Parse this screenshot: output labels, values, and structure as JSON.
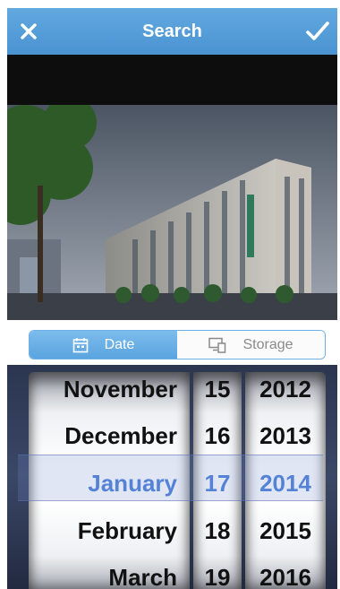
{
  "header": {
    "title": "Search",
    "close_icon": "close-icon",
    "confirm_icon": "checkmark-icon"
  },
  "tabs": [
    {
      "label": "Date",
      "icon": "calendar-icon",
      "active": true
    },
    {
      "label": "Storage",
      "icon": "devices-icon",
      "active": false
    }
  ],
  "picker": {
    "months": [
      "November",
      "December",
      "January",
      "February",
      "March"
    ],
    "days": [
      "15",
      "16",
      "17",
      "18",
      "19"
    ],
    "years": [
      "2012",
      "2013",
      "2014",
      "2015",
      "2016"
    ],
    "selected": {
      "month": "January",
      "day": "17",
      "year": "2014"
    }
  },
  "colors": {
    "header": "#4a93d2",
    "accent": "#5aa4df",
    "selected_text": "#4a7fd8"
  }
}
